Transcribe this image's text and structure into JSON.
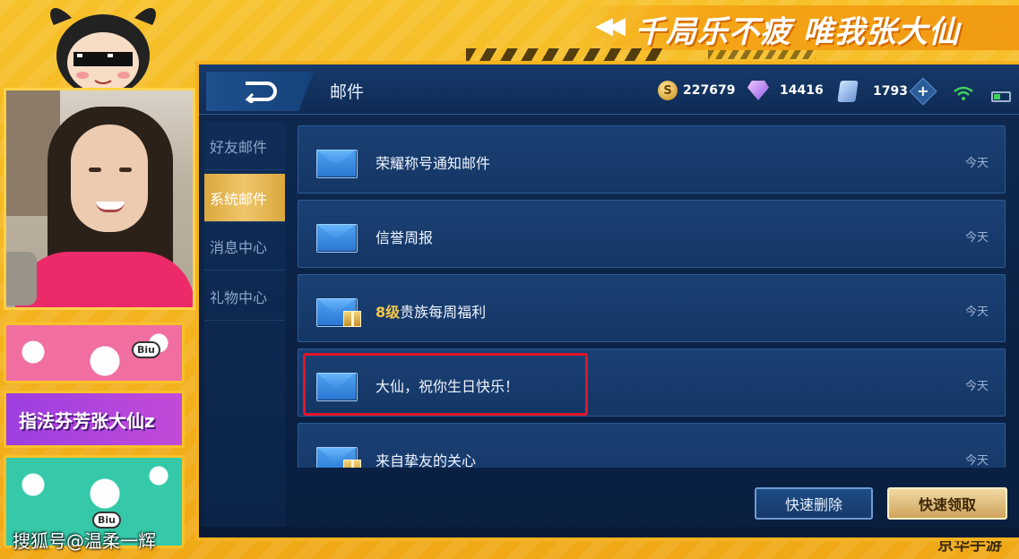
{
  "overlay": {
    "slogan_arrows": "◀◀",
    "slogan": "千局乐不疲 唯我张大仙",
    "name_tag": "指法芬芳张大仙z",
    "watermark": "搜狐号@温柔一辉",
    "corner_watermark": "京华手游",
    "sticker_bubble": "Biu"
  },
  "game": {
    "page_title": "邮件",
    "resources": {
      "gold": "227679",
      "gold_symbol": "S",
      "diamonds": "14416",
      "vouchers": "1793",
      "plus": "+"
    },
    "tabs": [
      {
        "label": "好友邮件",
        "active": false
      },
      {
        "label": "系统邮件",
        "active": true
      },
      {
        "label": "消息中心",
        "active": false
      },
      {
        "label": "礼物中心",
        "active": false
      }
    ],
    "mails": [
      {
        "level": "",
        "title": "荣耀称号通知邮件",
        "date": "今天",
        "gift": false
      },
      {
        "level": "",
        "title": "信誉周报",
        "date": "今天",
        "gift": false
      },
      {
        "level": "8级",
        "title": "贵族每周福利",
        "date": "今天",
        "gift": true
      },
      {
        "level": "",
        "title": "大仙，祝你生日快乐！",
        "date": "今天",
        "gift": false
      },
      {
        "level": "",
        "title": "来自挚友的关心",
        "date": "今天",
        "gift": true
      }
    ],
    "buttons": {
      "quick_delete": "快速删除",
      "quick_claim": "快速领取"
    }
  },
  "colors": {
    "overlay_yellow": "#f2b41c",
    "game_navy": "#0f2a52",
    "highlight_red": "#e0162a",
    "gold_button": "#cfa35b"
  }
}
